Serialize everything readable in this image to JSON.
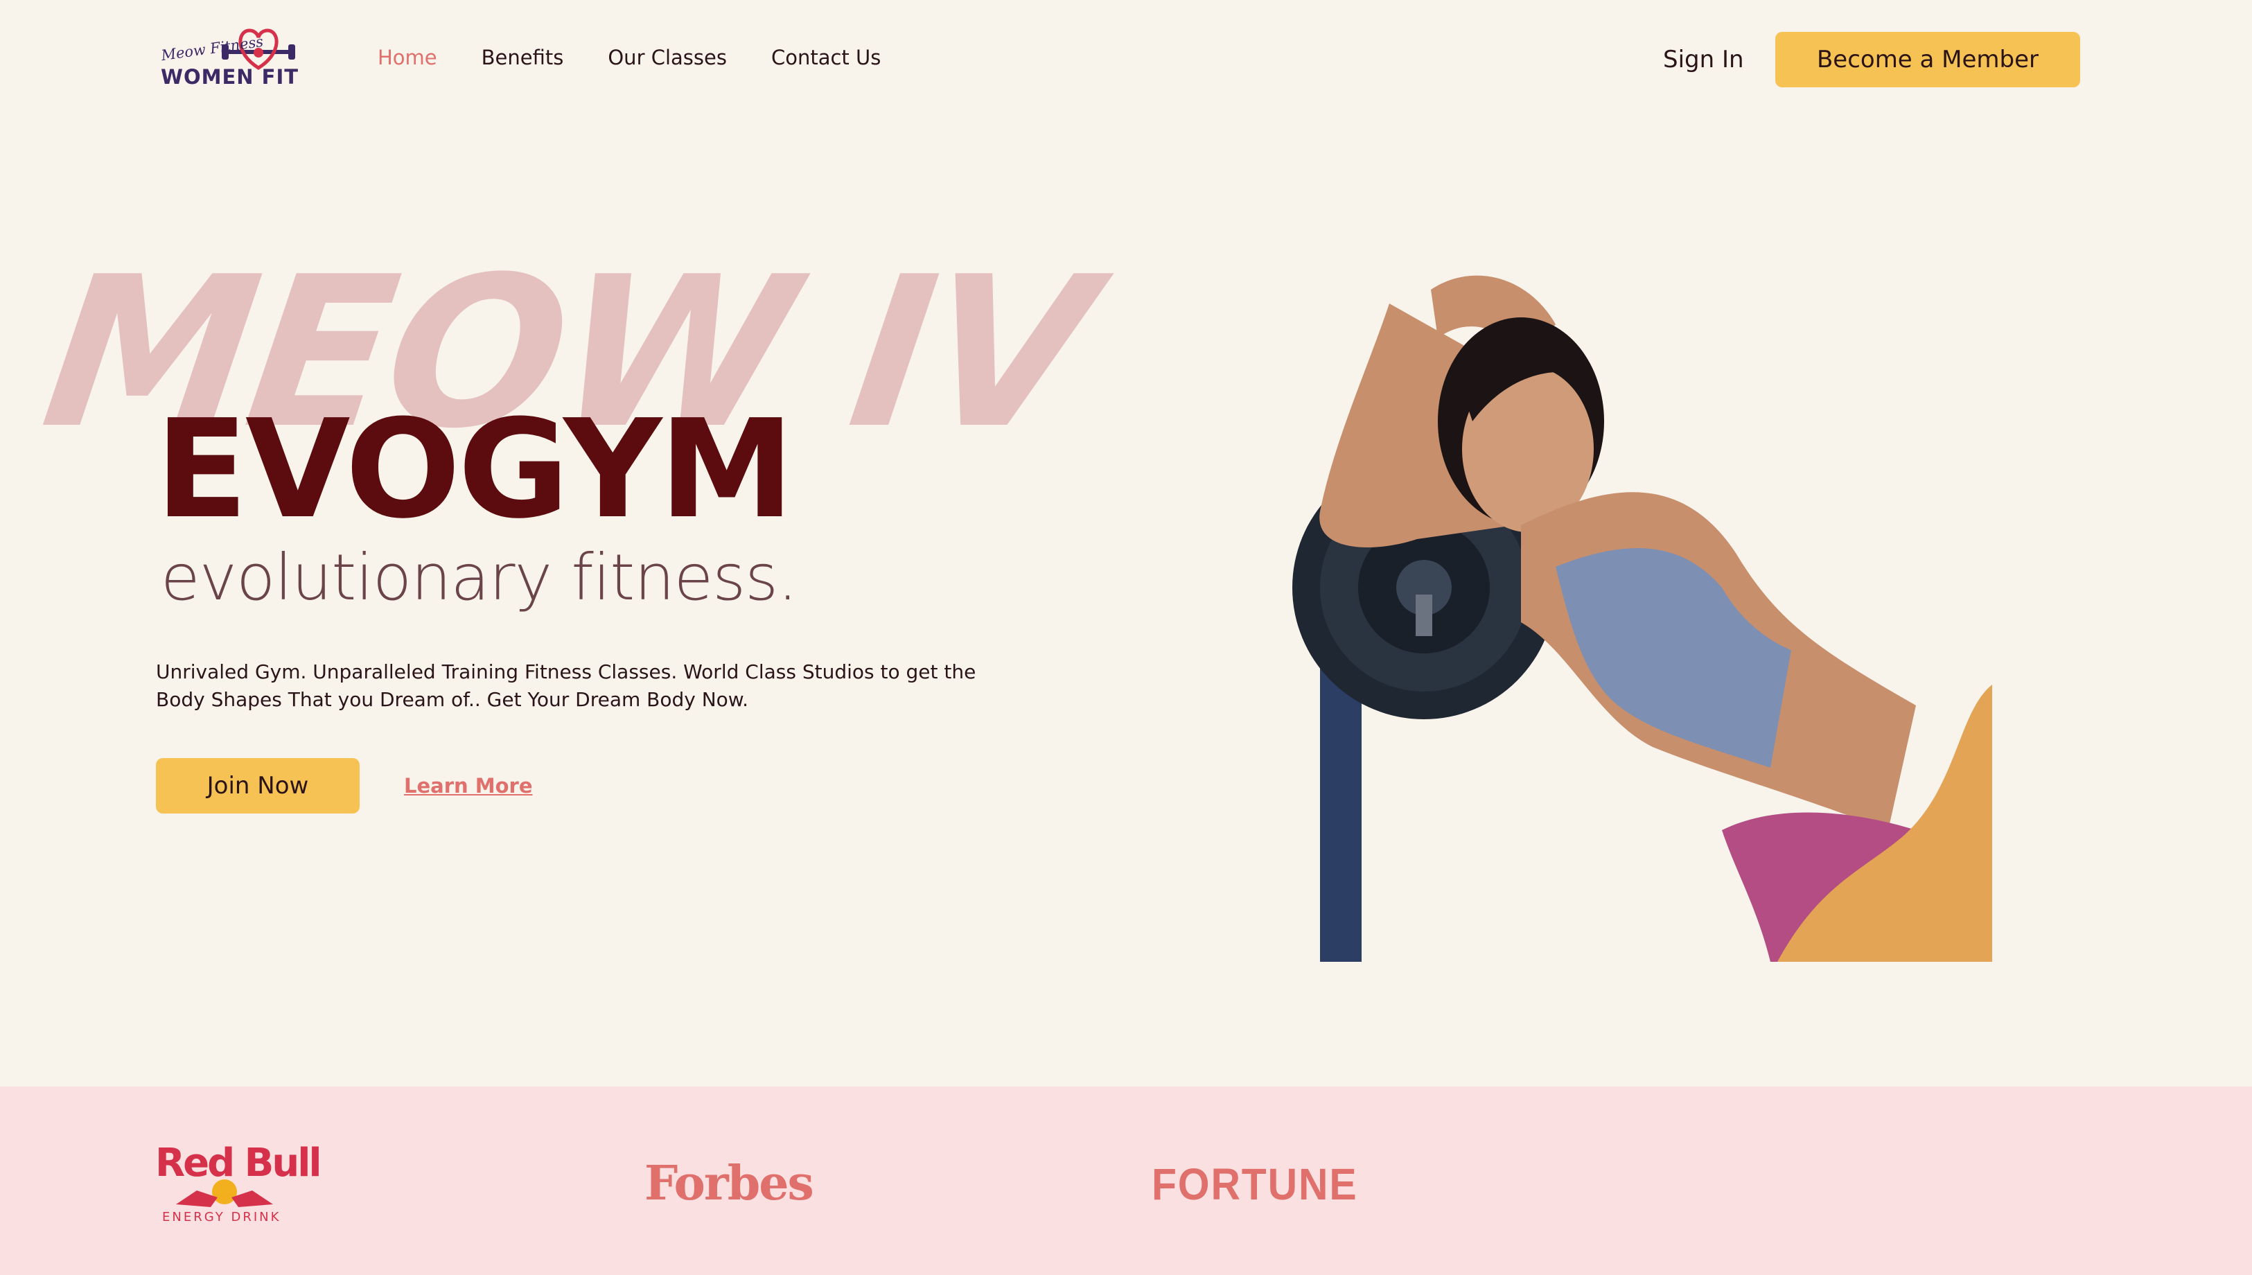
{
  "brand": {
    "logo_script": "Meow Fitness",
    "logo_main": "WOMEN FIT",
    "colors": {
      "accent_yellow": "#f6c253",
      "accent_coral": "#e0706c",
      "title_maroon": "#5c0c0e",
      "background": "#f8f4ec",
      "sponsor_band": "#fae0e0"
    }
  },
  "nav": {
    "links": [
      {
        "label": "Home",
        "active": true
      },
      {
        "label": "Benefits",
        "active": false
      },
      {
        "label": "Our Classes",
        "active": false
      },
      {
        "label": "Contact Us",
        "active": false
      }
    ],
    "sign_in": "Sign In",
    "member_button": "Become a Member"
  },
  "hero": {
    "background_word": "MEOW IV",
    "title": "EVOGYM",
    "subtitle": "evolutionary fitness.",
    "description": "Unrivaled Gym. Unparalleled Training Fitness Classes. World Class Studios to get the Body Shapes That you Dream of.. Get Your Dream Body Now.",
    "join_button": "Join Now",
    "learn_more": "Learn More",
    "image_icon": "woman-with-weight-plate-photo"
  },
  "sponsors": {
    "items": [
      {
        "name": "Red Bull",
        "sub": "ENERGY DRINK"
      },
      {
        "name": "Forbes"
      },
      {
        "name": "FORTUNE"
      }
    ]
  }
}
